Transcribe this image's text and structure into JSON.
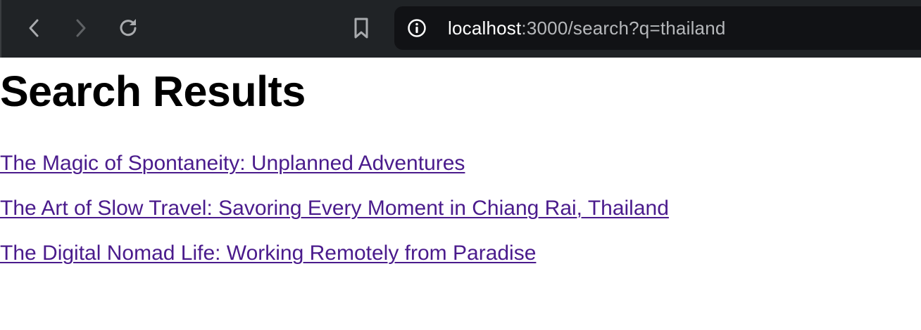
{
  "browser": {
    "url_host": "localhost",
    "url_rest": ":3000/search?q=thailand",
    "icons": {
      "back": "chevron-left",
      "forward": "chevron-right",
      "reload": "reload",
      "bookmark": "bookmark",
      "site_info": "info-circle"
    },
    "colors": {
      "toolbar_bg": "#202326",
      "address_bg": "#111215",
      "url_host": "#ffffff",
      "url_rest": "#b6b8bb"
    }
  },
  "page": {
    "title": "Search Results",
    "results": [
      {
        "label": "The Magic of Spontaneity: Unplanned Adventures"
      },
      {
        "label": "The Art of Slow Travel: Savoring Every Moment in Chiang Rai, Thailand"
      },
      {
        "label": "The Digital Nomad Life: Working Remotely from Paradise"
      }
    ],
    "link_color": "#4a1b8c"
  }
}
